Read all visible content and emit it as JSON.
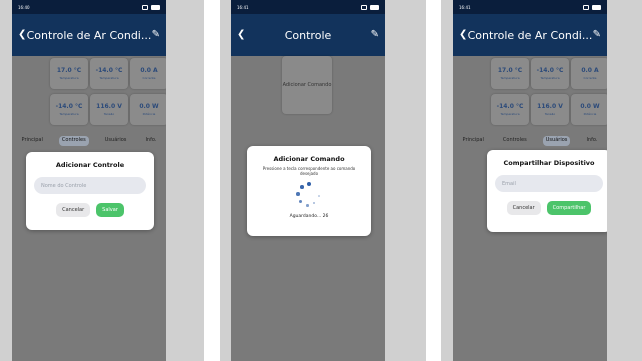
{
  "colors": {
    "status_bar": "#0a1e3c",
    "app_bar": "#12335c",
    "overlay_bg": "#7a7a7a",
    "accent_green": "#4cc46a",
    "value_blue": "#2b4a7a"
  },
  "screens": [
    {
      "status_time": "16:40",
      "title": "Controle de Ar Condi...",
      "cards": [
        {
          "value": "17.0 °C",
          "label": "Temperatura"
        },
        {
          "value": "-14.0 °C",
          "label": "Temperatura"
        },
        {
          "value": "0.0 A",
          "label": "Corrente"
        },
        {
          "value": "-14.0 °C",
          "label": "Temperatura"
        },
        {
          "value": "116.0 V",
          "label": "Tensão"
        },
        {
          "value": "0.0 W",
          "label": "Potência"
        }
      ],
      "tabs": [
        "Principal",
        "Controles",
        "Usuários",
        "Info."
      ],
      "active_tab": "Controles",
      "dialog": {
        "title": "Adicionar Controle",
        "placeholder": "Nome do Controle",
        "cancel": "Cancelar",
        "confirm": "Salvar"
      }
    },
    {
      "status_time": "16:41",
      "title": "Controle",
      "add_command_card": "Adicionar Comando",
      "dialog": {
        "title": "Adicionar Comando",
        "instruction": "Pressione a tecla correspondente ao comando desejado",
        "waiting": "Aguardando... 26"
      }
    },
    {
      "status_time": "16:41",
      "title": "Controle de Ar Condi...",
      "cards": [
        {
          "value": "17.0 °C",
          "label": "Temperatura"
        },
        {
          "value": "-14.0 °C",
          "label": "Temperatura"
        },
        {
          "value": "0.0 A",
          "label": "Corrente"
        },
        {
          "value": "-14.0 °C",
          "label": "Temperatura"
        },
        {
          "value": "116.0 V",
          "label": "Tensão"
        },
        {
          "value": "0.0 W",
          "label": "Potência"
        }
      ],
      "tabs": [
        "Principal",
        "Controles",
        "Usuários",
        "Info."
      ],
      "active_tab": "Usuários",
      "dialog": {
        "title": "Compartilhar Dispositivo",
        "placeholder": "Email",
        "cancel": "Cancelar",
        "confirm": "Compartilhar"
      }
    }
  ],
  "icons": [
    "back-arrow-icon",
    "edit-pencil-icon",
    "wifi-icon",
    "battery-icon",
    "loading-spinner-icon"
  ]
}
